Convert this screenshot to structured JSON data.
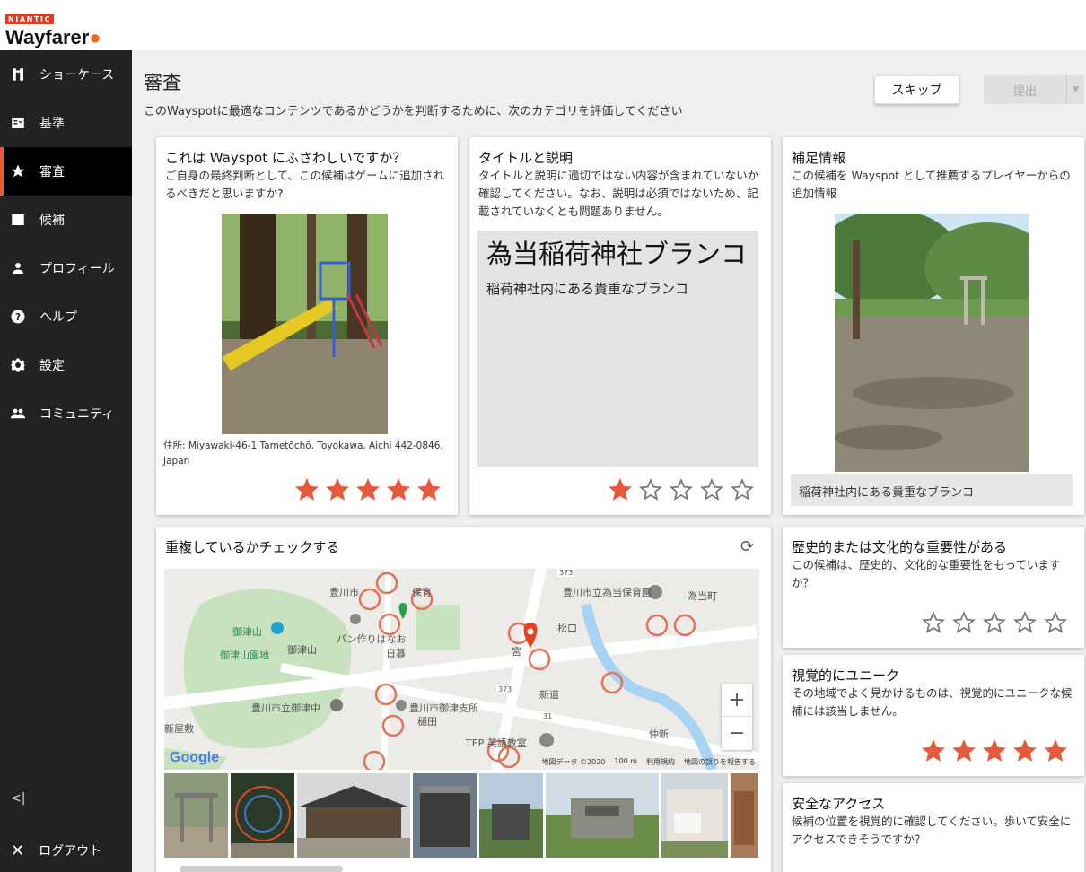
{
  "brand": {
    "company": "NIANTIC",
    "product": "Wayfarer"
  },
  "sidebar": {
    "items": [
      {
        "label": "ショーケース",
        "icon": "showcase-icon"
      },
      {
        "label": "基準",
        "icon": "criteria-icon"
      },
      {
        "label": "審査",
        "icon": "star-icon",
        "active": true
      },
      {
        "label": "候補",
        "icon": "nominations-icon"
      },
      {
        "label": "プロフィール",
        "icon": "person-icon"
      },
      {
        "label": "ヘルプ",
        "icon": "help-icon"
      },
      {
        "label": "設定",
        "icon": "gear-icon"
      },
      {
        "label": "コミュニティ",
        "icon": "community-icon"
      }
    ],
    "collapse": "<|",
    "logout": "ログアウト"
  },
  "header": {
    "title": "審査",
    "subtitle": "このWayspotに最適なコンテンツであるかどうかを判断するために、次のカテゴリを評価してください",
    "skip_label": "スキップ",
    "submit_label": "提出"
  },
  "cards": {
    "appropriate": {
      "title": "これは Wayspot にふさわしいですか？",
      "desc": "ご自身の最終判断として、この候補はゲームに追加されるべきだと思いますか?",
      "address": "住所: Miyawaki-46-1 Tametōchō, Toyokawa, Aichi 442-0846, Japan",
      "rating": 5
    },
    "title_desc": {
      "title": "タイトルと説明",
      "desc": "タイトルと説明に適切ではない内容が含まれていないか確認してください。なお、説明は必須ではないため、記載されていなくとも問題ありません。",
      "candidate_title": "為当稲荷神社ブランコ",
      "candidate_desc": "稲荷神社内にある貴重なブランコ",
      "rating": 1
    },
    "supplemental": {
      "title": "補足情報",
      "desc": "この候補を Wayspot として推薦するプレイヤーからの追加情報",
      "caption": "稲荷神社内にある貴重なブランコ"
    },
    "duplicates": {
      "title": "重複しているかチェックする",
      "map_labels": [
        "豊川市立為当保育園",
        "為当町",
        "御津山",
        "御津山園地",
        "御津山",
        "パン作りはなお",
        "日暮",
        "豊川市立御津中",
        "豊川市御津支所",
        "樋田",
        "新屋敷",
        "TEP 英語教室",
        "新道",
        "仲新",
        "松口",
        "宮",
        "豊川市",
        "保育"
      ],
      "road_numbers": [
        "373",
        "31",
        "373"
      ],
      "map_footer": [
        "地図データ ©2020",
        "100 m",
        "利用規約",
        "地図の誤りを報告する"
      ],
      "google": "Google"
    },
    "cultural": {
      "title": "歴史的または文化的な重要性がある",
      "desc": "この候補は、歴史的、文化的な重要性をもっていますか？",
      "rating": 0
    },
    "visual": {
      "title": "視覚的にユニーク",
      "desc": "その地域でよく見かけるものは、視覚的にユニークな候補には該当しません。",
      "rating": 5
    },
    "safety": {
      "title": "安全なアクセス",
      "desc": "候補の位置を視覚的に確認してください。歩いて安全にアクセスできそうですか？"
    }
  },
  "colors": {
    "accent": "#e55a3a",
    "star_filled": "#e55a3a",
    "star_empty": "#777777",
    "sidebar": "#222222"
  }
}
